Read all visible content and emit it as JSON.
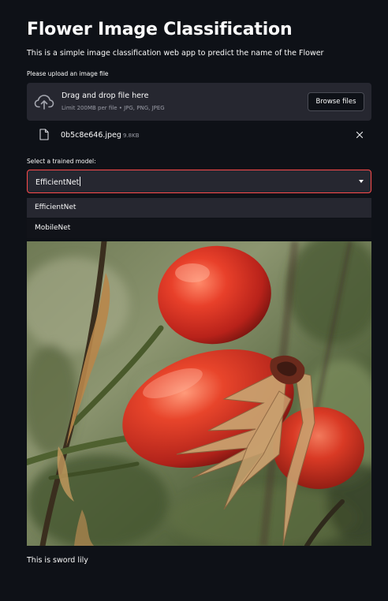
{
  "app": {
    "title": "Flower Image Classification",
    "description": "This is a simple image classification web app to predict the name of the Flower"
  },
  "uploader": {
    "label": "Please upload an image file",
    "drag_text": "Drag and drop file here",
    "limit_text": "Limit 200MB per file • JPG, PNG, JPEG",
    "browse_label": "Browse files",
    "icon": "cloud-upload-icon"
  },
  "uploaded_file": {
    "name": "0b5c8e646.jpeg",
    "size": "9.8KB",
    "icon": "file-icon",
    "remove_icon": "close-icon"
  },
  "model_select": {
    "label": "Select a trained model:",
    "value": "EfficientNet",
    "options": [
      "EfficientNet",
      "MobileNet"
    ],
    "highlighted_index": 0,
    "accent_color": "#ff4b4b"
  },
  "image": {
    "subject": "rose-hips-photo"
  },
  "prediction": {
    "text": "This is sword lily"
  },
  "colors": {
    "background": "#0e1117",
    "panel": "#262730",
    "text": "#fafafa",
    "muted_text": "#9a9ca6",
    "accent": "#ff4b4b"
  }
}
